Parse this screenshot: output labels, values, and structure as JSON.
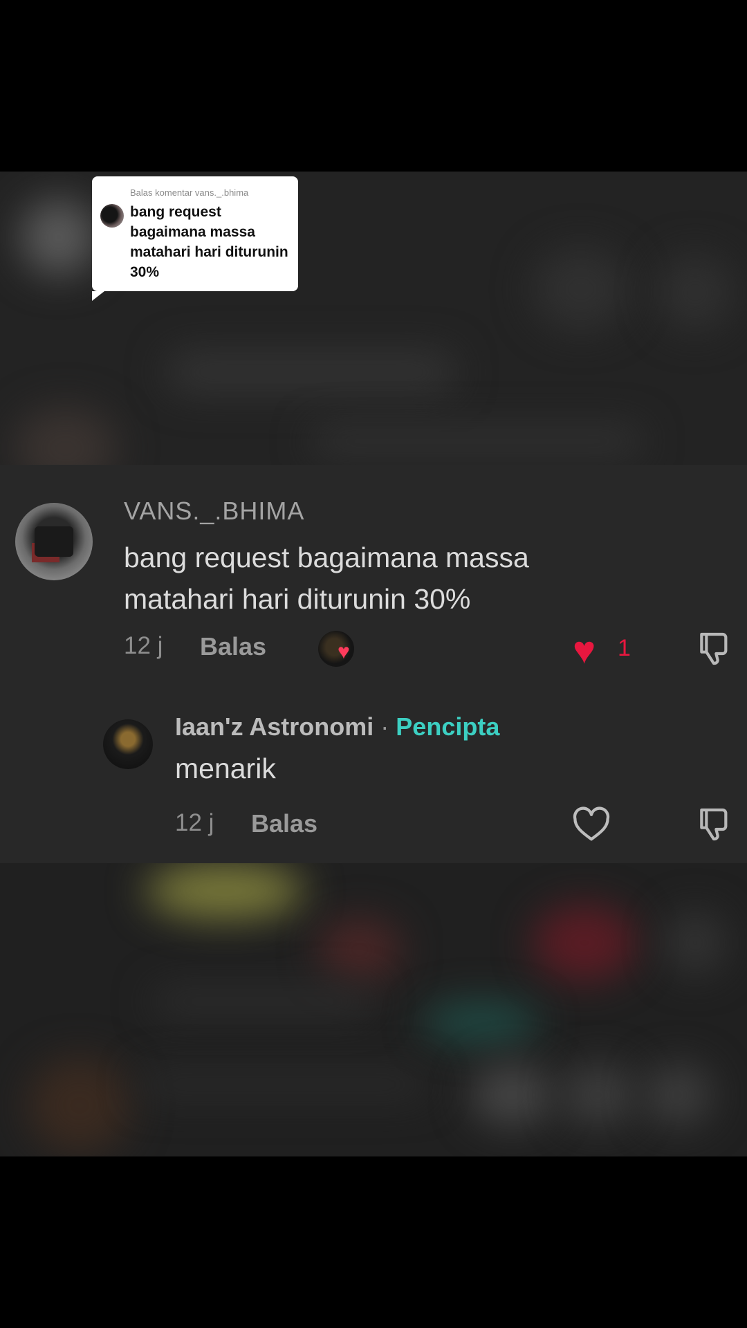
{
  "sticker": {
    "header": "Balas komentar vans._.bhima",
    "text": "bang request bagaimana massa matahari hari diturunin 30%"
  },
  "comment": {
    "username": "VANS._.BHIMA",
    "text_line1": "bang request bagaimana massa",
    "text_line2": "matahari hari diturunin 30%",
    "time": "12 j",
    "reply_label": "Balas",
    "like_count": "1",
    "liked": true,
    "liked_by_creator": true
  },
  "reply": {
    "username": "Iaan'z Astronomi",
    "separator": "·",
    "badge": "Pencipta",
    "text": "menarik",
    "time": "12 j",
    "reply_label": "Balas",
    "liked": false
  },
  "colors": {
    "like_red": "#e8173f",
    "creator_badge": "#3ccfc2",
    "background": "#262626"
  },
  "icons": [
    "heart-filled-icon",
    "heart-outline-icon",
    "dislike-icon",
    "creator-like-heart-icon"
  ]
}
